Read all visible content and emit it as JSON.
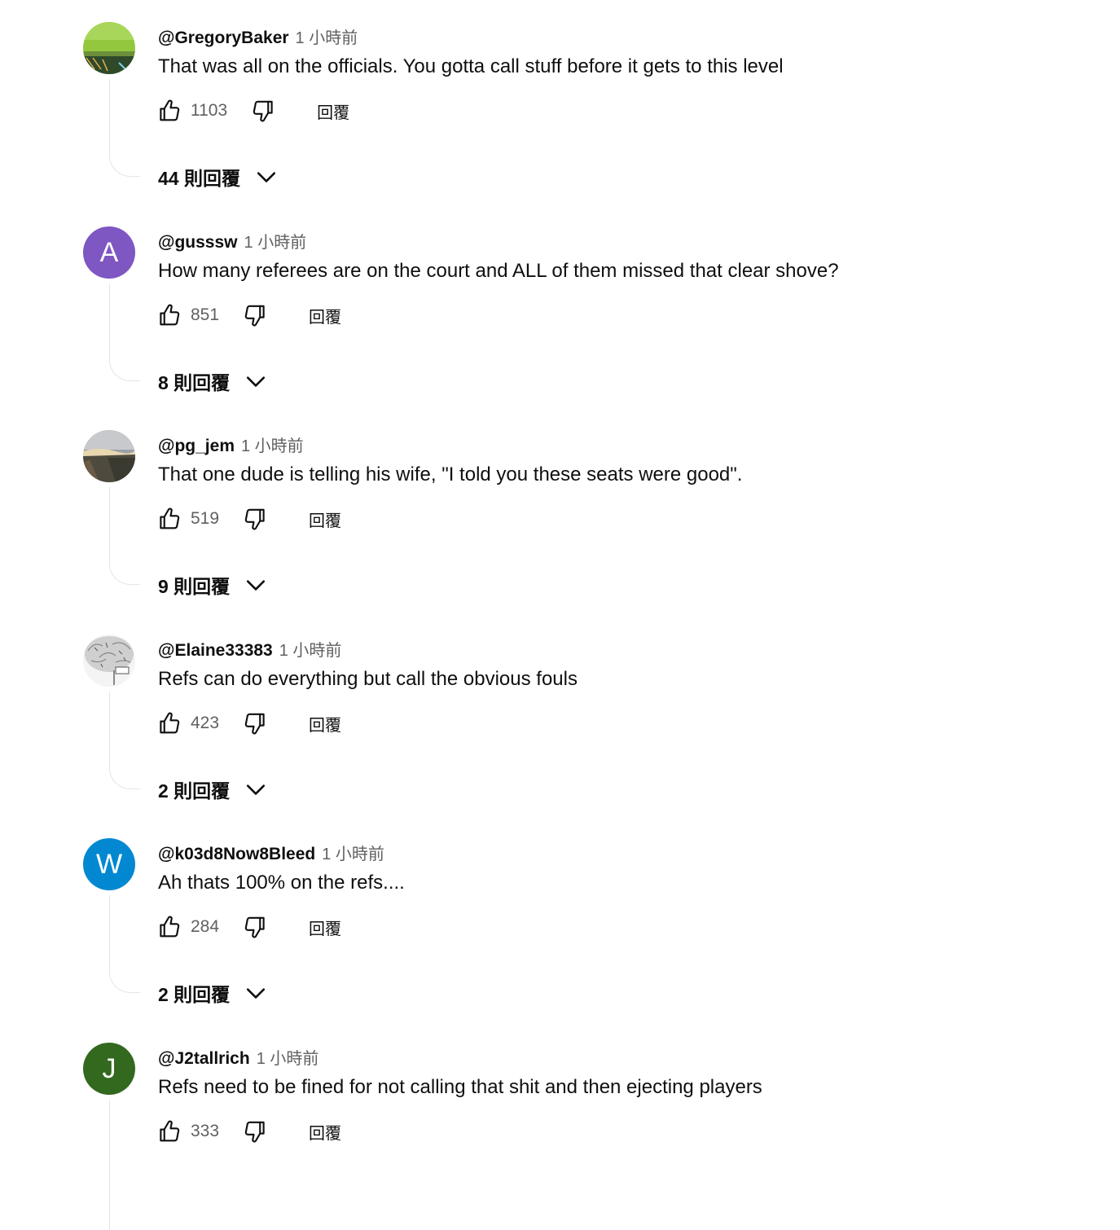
{
  "comments": [
    {
      "author": "@GregoryBaker",
      "time": "1 小時前",
      "text": "That was all on the officials. You gotta call stuff before it gets to this level",
      "likes": "1103",
      "reply_label": "回覆",
      "replies_label": "44 則回覆",
      "avatar": {
        "type": "image",
        "icon": "green-court-photo-avatar",
        "color": "#8fc23a"
      }
    },
    {
      "author": "@gusssw",
      "time": "1 小時前",
      "text": "How many referees are on the court and ALL of them missed that clear shove?",
      "likes": "851",
      "reply_label": "回覆",
      "replies_label": "8 則回覆",
      "avatar": {
        "type": "letter",
        "letter": "A",
        "color": "#7e57c2"
      }
    },
    {
      "author": "@pg_jem",
      "time": "1 小時前",
      "text": "That one dude is telling his wife, \"I told you these seats were good\".",
      "likes": "519",
      "reply_label": "回覆",
      "replies_label": "9 則回覆",
      "avatar": {
        "type": "image",
        "icon": "landscape-photo-avatar",
        "color": "#7a7f86"
      }
    },
    {
      "author": "@Elaine33383",
      "time": "1 小時前",
      "text": "Refs can do everything but call the obvious fouls",
      "likes": "423",
      "reply_label": "回覆",
      "replies_label": "2 則回覆",
      "avatar": {
        "type": "image",
        "icon": "sketch-tree-avatar",
        "color": "#d8d8d8"
      }
    },
    {
      "author": "@k03d8Now8Bleed",
      "time": "1 小時前",
      "text": "Ah thats 100% on the refs....",
      "likes": "284",
      "reply_label": "回覆",
      "replies_label": "2 則回覆",
      "avatar": {
        "type": "letter",
        "letter": "W",
        "color": "#0288d1"
      }
    },
    {
      "author": "@J2tallrich",
      "time": "1 小時前",
      "text": "Refs need to be fined for not calling that shit and then ejecting players",
      "likes": "333",
      "reply_label": "回覆",
      "replies_label": "",
      "avatar": {
        "type": "letter",
        "letter": "J",
        "color": "#33691e"
      }
    }
  ]
}
